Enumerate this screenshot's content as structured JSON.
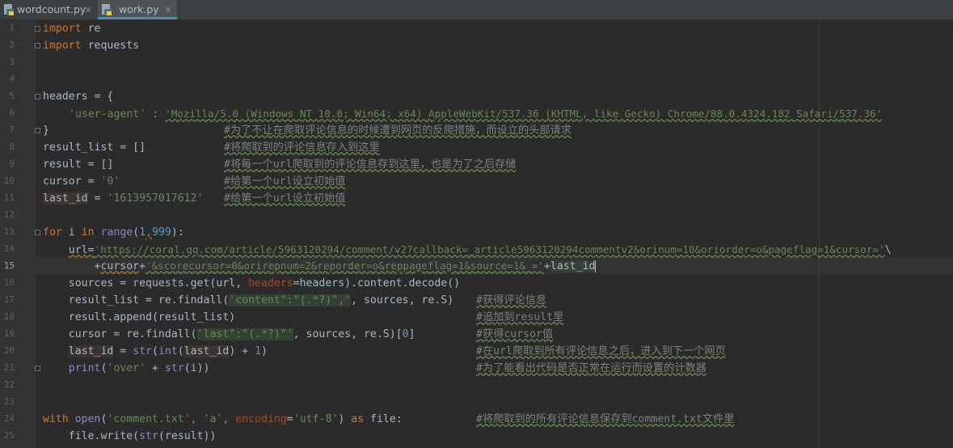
{
  "tabs": [
    {
      "name": "wordcount.py",
      "close": "×",
      "active": false
    },
    {
      "name": "work.py",
      "close": "×",
      "active": true
    }
  ],
  "line_numbers": [
    "1",
    "2",
    "3",
    "4",
    "5",
    "6",
    "7",
    "8",
    "9",
    "10",
    "11",
    "12",
    "13",
    "14",
    "15",
    "16",
    "17",
    "18",
    "19",
    "20",
    "21",
    "22",
    "23",
    "24",
    "25"
  ],
  "current_line": "15",
  "code": {
    "l1": {
      "kw": "import",
      "rest": " re"
    },
    "l2": {
      "kw": "import",
      "rest": " requests"
    },
    "l5": {
      "text": "headers = {"
    },
    "l6": {
      "key": "'user-agent'",
      "sep": " : ",
      "value": "'Mozilla/5.0 (Windows NT 10.0; Win64; x64) AppleWebKit/537.36 (KHTML, like Gecko) Chrome/88.0.4324.182 Safari/537.36'"
    },
    "l7": {
      "text": "}",
      "comment": "#为了不让在爬取评论信息的时候遭到网页的反爬措施，而设立的头部请求"
    },
    "l8": {
      "text": "result_list = []",
      "comment": "#将爬取到的评论信息存入到这里"
    },
    "l9": {
      "text": "result = []",
      "comment": "#将每一个url爬取到的评论信息存到这里，也是为了之后存储"
    },
    "l10": {
      "var": "cursor",
      "eq": " = ",
      "value": "'0'",
      "comment": "#给第一个url设立初始值"
    },
    "l11": {
      "var": "last_id",
      "eq": " = ",
      "value": "'1613957017612'",
      "comment": "#给第一个url设立初始值"
    },
    "l13": {
      "kw_for": "for",
      "i": " i ",
      "kw_in": "in",
      "sp": " ",
      "range": "range",
      "open": "(",
      "n1": "1",
      "comma": ",",
      "n2": "999",
      "close": "):"
    },
    "l14": {
      "indent": "    ",
      "prefix": "url=",
      "value": "'https://coral.qq.com/article/5963120294/comment/v2?callback=_article5963120294commentv2&orinum=10&oriorder=o&pageflag=1&cursor='",
      "suffix": "\\"
    },
    "l15": {
      "indent": "        ",
      "plus1": "+",
      "cursor": "cursor",
      "plus2": "+",
      "value": "'&scorecursor=0&orirepnum=2&reporder=o&reppageflag=1&source=1&_='",
      "plus3": "+",
      "last_id": "last_id"
    },
    "l16": {
      "indent": "    ",
      "pre": "sources = requests.get(url, ",
      "kwarg": "headers",
      "post": "=headers).content.decode()"
    },
    "l17": {
      "indent": "    ",
      "pre": "result_list = re.findall(",
      "value": "'content\":\"(.*?)\",'",
      "post": ", sources, re.S)",
      "comment": "#获得评论信息"
    },
    "l18": {
      "indent": "    ",
      "text": "result.append(result_list)",
      "comment": "#追加到result里"
    },
    "l19": {
      "indent": "    ",
      "pre": "cursor = re.findall(",
      "value": "'last\":\"(.*?)\"'",
      "mid": ", sources, re.S)[",
      "num": "0",
      "post": "]",
      "comment": "#获得cursor值"
    },
    "l20": {
      "indent": "    ",
      "var": "last_id",
      "eq": " = ",
      "str": "str",
      "o1": "(",
      "int": "int",
      "o2": "(",
      "var2": "last_id",
      "mid": ") + ",
      "num": "1",
      "post": ")",
      "comment": "#在url爬取到所有评论信息之后，进入到下一个网页"
    },
    "l21": {
      "indent": "    ",
      "print": "print",
      "o1": "(",
      "value": "'over'",
      "mid": " + ",
      "str": "str",
      "post": "(i))",
      "comment": "#为了能看出代码是否正常在运行而设置的计数器"
    },
    "l24": {
      "with": "with",
      "sp": " ",
      "open": "open",
      "o1": "(",
      "v1": "'comment.txt'",
      "c1": ", ",
      "v2": "'a'",
      "c2": ", ",
      "kwarg": "encoding",
      "eq": "=",
      "v3": "'utf-8'",
      "c3": ") ",
      "as": "as",
      "post": " file:",
      "comment": "#将爬取到的所有评论信息保存到comment.txt文件里"
    },
    "l25": {
      "indent": "    ",
      "pre": "file.write(",
      "str": "str",
      "post": "(result))"
    }
  },
  "colors": {
    "background": "#2b2b2b",
    "keyword": "#cc7832",
    "string": "#6a8759",
    "number": "#6897bb",
    "comment": "#808080",
    "builtin": "#8888c6",
    "link": "#287bde"
  },
  "icons": [
    "python-file-icon",
    "close-icon"
  ]
}
